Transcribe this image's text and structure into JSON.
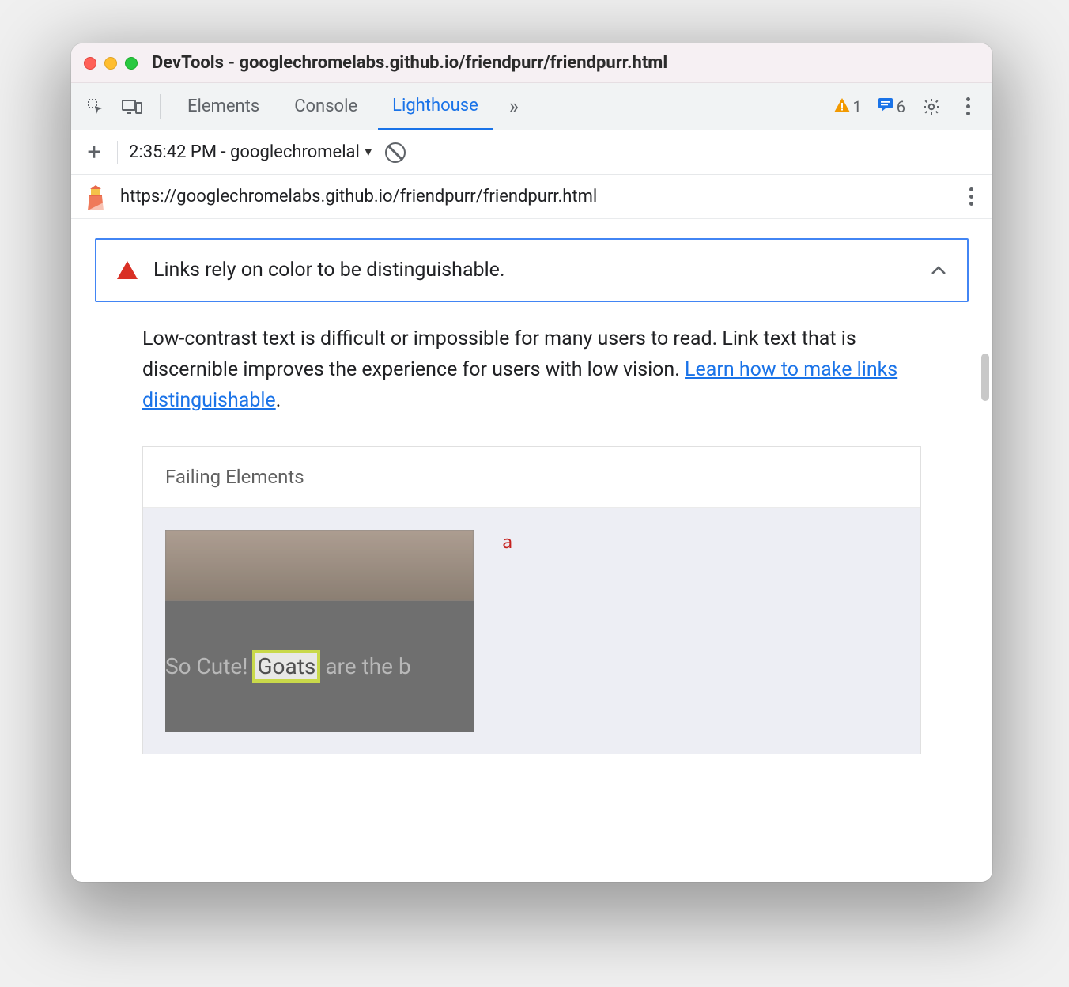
{
  "window": {
    "title": "DevTools - googlechromelabs.github.io/friendpurr/friendpurr.html"
  },
  "tabs": {
    "items": [
      "Elements",
      "Console",
      "Lighthouse"
    ],
    "active_index": 2,
    "overflow_glyph": "»",
    "warning_count": "1",
    "message_count": "6"
  },
  "subbar": {
    "report_label": "2:35:42 PM - googlechromelal"
  },
  "urlbar": {
    "url": "https://googlechromelabs.github.io/friendpurr/friendpurr.html"
  },
  "audit": {
    "title": "Links rely on color to be distinguishable.",
    "description_pre": "Low-contrast text is difficult or impossible for many users to read. Link text that is discernible improves the experience for users with low vision. ",
    "learn_link": "Learn how to make links distinguishable",
    "description_post": "."
  },
  "failing": {
    "heading": "Failing Elements",
    "tag": "a",
    "thumb_text_pre": "So Cute! ",
    "thumb_text_hl": "Goats",
    "thumb_text_post": " are the b"
  }
}
